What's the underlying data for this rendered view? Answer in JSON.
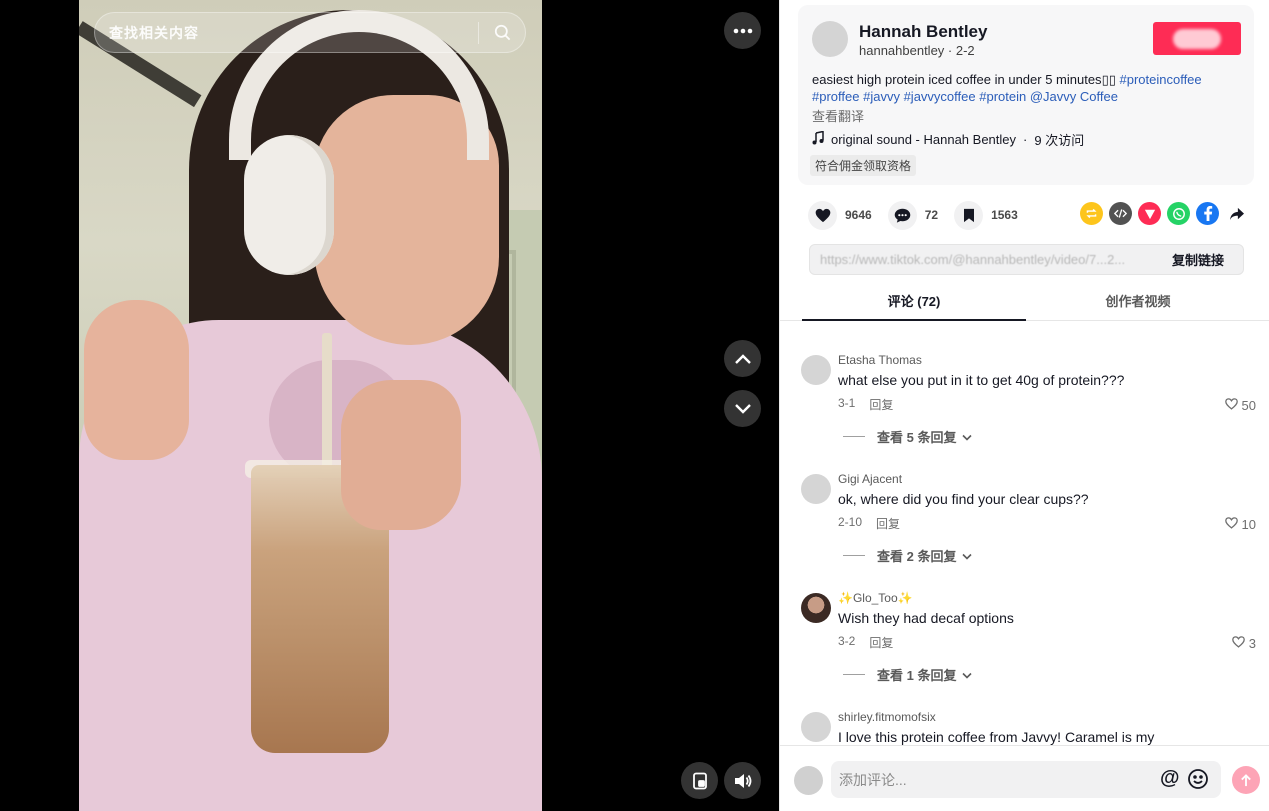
{
  "video": {
    "search_placeholder": "查找相关内容",
    "icons": {
      "search": "search-icon",
      "more": "more-dots-icon",
      "up": "chevron-up-icon",
      "down": "chevron-down-icon",
      "pip": "picture-in-picture-icon",
      "volume": "volume-icon"
    }
  },
  "post": {
    "author_name": "Hannah Bentley",
    "author_handle": "hannahbentley",
    "date": "2-2",
    "caption_text": "easiest high protein iced coffee in under 5 minutes",
    "caption_tags": [
      "#proteincoffee",
      "#proffee",
      "#javvy",
      "#javvycoffee",
      "#protein",
      "@Javvy Coffee"
    ],
    "translate_label": "查看翻译",
    "sound_title": "original sound - Hannah Bentley",
    "sound_visits": "9 次访问",
    "eligibility_badge": "符合佣金领取资格"
  },
  "actions": {
    "likes": "9646",
    "comments": "72",
    "saves": "1563"
  },
  "share": {
    "link_text": "https://www.tiktok.com/@hannahbentley/video/7...2...",
    "copy_label": "复制链接",
    "icons": [
      "repost-icon",
      "embed-icon",
      "send-icon",
      "whatsapp-icon",
      "facebook-icon",
      "share-arrow-icon"
    ]
  },
  "tabs": {
    "comments_label": "评论 (72)",
    "videos_label": "创作者视频"
  },
  "comments": [
    {
      "user": "Etasha Thomas",
      "text": "what else you put in it to get 40g of protein???",
      "date": "3-1",
      "reply_label": "回复",
      "likes": "50",
      "view_replies": "查看 5 条回复"
    },
    {
      "user": "Gigi Ajacent",
      "text": "ok, where did you find your clear cups??",
      "date": "2-10",
      "reply_label": "回复",
      "likes": "10",
      "view_replies": "查看 2 条回复"
    },
    {
      "user": "Glo_Too",
      "text": "Wish they had decaf options",
      "date": "3-2",
      "reply_label": "回复",
      "likes": "3",
      "view_replies": "查看 1 条回复"
    },
    {
      "user": "shirley.fitmomofsix",
      "text": "I love this protein coffee from Javvy! Caramel is my"
    }
  ],
  "composer": {
    "placeholder": "添加评论...",
    "mention_symbol": "@"
  },
  "colors": {
    "accent": "#fe2c55",
    "link": "#2b5db9",
    "post_disabled": "#fda4b6"
  }
}
